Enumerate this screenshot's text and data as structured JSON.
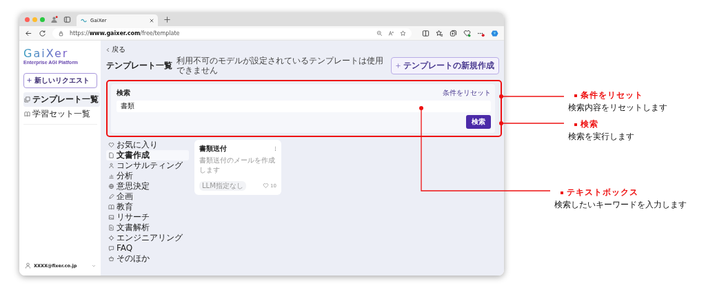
{
  "browser": {
    "tab_title": "GaiXer",
    "url": "https://**www.gaixer.com**/free/template"
  },
  "sidebar": {
    "logo": "GaiXer",
    "tagline": "Enterprise AGI Platform",
    "new_request_button": "新しいリクエスト",
    "items": [
      {
        "label": "テンプレート一覧",
        "selected": true
      },
      {
        "label": "学習セット一覧",
        "selected": false
      }
    ],
    "user": "XXXX@fixer.co.jp"
  },
  "header": {
    "back": "戻る",
    "title": "テンプレート一覧",
    "note": "利用不可のモデルが設定されているテンプレートは使用できません",
    "create_button": "テンプレートの新規作成"
  },
  "search": {
    "title": "検索",
    "reset_link": "条件をリセット",
    "value": "書類",
    "button": "検索"
  },
  "categories": [
    {
      "label": "お気に入り",
      "selected": false
    },
    {
      "label": "文書作成",
      "selected": true
    },
    {
      "label": "コンサルティング",
      "selected": false
    },
    {
      "label": "分析",
      "selected": false
    },
    {
      "label": "意思決定",
      "selected": false
    },
    {
      "label": "企画",
      "selected": false
    },
    {
      "label": "教育",
      "selected": false
    },
    {
      "label": "リサーチ",
      "selected": false
    },
    {
      "label": "文書解析",
      "selected": false
    },
    {
      "label": "エンジニアリング",
      "selected": false
    },
    {
      "label": "FAQ",
      "selected": false
    },
    {
      "label": "そのほか",
      "selected": false
    }
  ],
  "cards": [
    {
      "title": "書類送付",
      "description": "書類送付のメールを作成します",
      "tag": "LLM指定なし",
      "likes": "10"
    }
  ],
  "annotations": [
    {
      "title": "条件をリセット",
      "description": "検索内容をリセットします"
    },
    {
      "title": "検索",
      "description": "検索を実行します"
    },
    {
      "title": "テキストボックス",
      "description": "検索したいキーワードを入力します"
    }
  ]
}
